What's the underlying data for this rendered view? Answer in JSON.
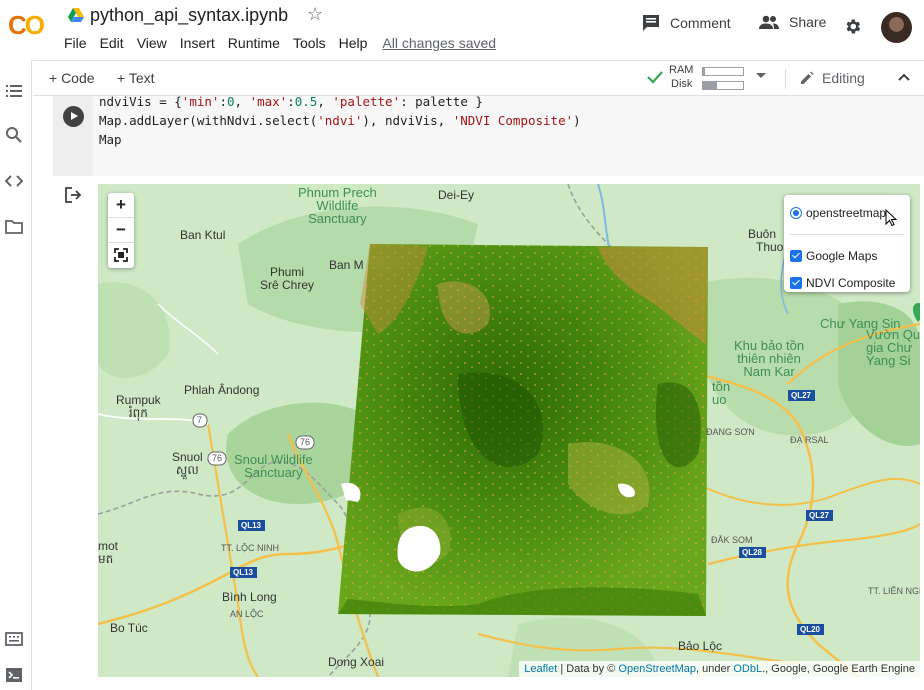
{
  "app": {
    "logo_text": "CO",
    "title": "python_api_syntax.ipynb"
  },
  "menu": [
    "File",
    "Edit",
    "View",
    "Insert",
    "Runtime",
    "Tools",
    "Help"
  ],
  "save_status": "All changes saved",
  "header": {
    "comment_label": "Comment",
    "share_label": "Share"
  },
  "toolbar": {
    "code_label": "+ Code",
    "text_label": "+ Text",
    "ram_label": "RAM",
    "disk_label": "Disk",
    "ram_usage": 0.05,
    "disk_usage": 0.35,
    "editing_label": "Editing"
  },
  "cell": {
    "code_lines": [
      "ndviVis = {'min':0, 'max':0.5, 'palette': palette }",
      "Map.addLayer(withNdvi.select('ndvi'), ndviVis, 'NDVI Composite')",
      "Map"
    ]
  },
  "map": {
    "zoom_in": "+",
    "zoom_out": "−",
    "fullscreen_icon": "fullscreen-icon",
    "layers": {
      "base": "openstreetmap",
      "overlays": [
        "Google Maps",
        "NDVI Composite"
      ]
    },
    "labels": {
      "phnum_prech": "Phnum Prech\nWildlife\nSanctuary",
      "dei_ey": "Dei-Ey",
      "ban_ktul": "Ban Ktul",
      "phumi": "Phumi\nSrê Chrey",
      "ban_m": "Ban M",
      "buon": "Buôn",
      "thuo": "Thuo",
      "chu_yang_sin": "Chư Yang Sin",
      "khu_bao_ton": "Khu bảo tồn\nthiên nhiên\nNam Kar",
      "vuon_qu": "Vườn Qu\ngia Chư\nYang Si",
      "phlah": "Phlah Ândong",
      "rumpuk": "Rumpuk\nរំពុក",
      "snuol": "Snuol\nស្នួល",
      "snoul_wildlife": "Snoul Wildlife\nSanctuary",
      "ton": "tồn\nuo",
      "ql27a": "QL27",
      "dang_son": "ĐANG SƠN",
      "da_rsal": "ĐẠ RSAL",
      "ql27b": "QL27",
      "ql13a": "QL13",
      "tt_loc_ninh": "TT. LỘC NINH",
      "ql13b": "QL13",
      "binh_long": "Bình Long",
      "an_loc": "AN LỘC",
      "bo_tuc": "Bo Túc",
      "dong_xoai": "Dong Xoai",
      "bao_loc": "Bảo Lộc",
      "ql20": "QL20",
      "dak_som": "ĐẮK SOM",
      "ql28": "QL28",
      "tt_lien_nghia": "TT. LIÊN NGH",
      "mot": "mot\nមត",
      "r7": "7",
      "r76a": "76",
      "r76b": "76"
    },
    "attribution": {
      "leaflet": "Leaflet",
      "text1": " | Data by © ",
      "osm": "OpenStreetMap",
      "text2": ", under ",
      "odbl": "ODbL",
      "text3": "., Google, Google Earth Engine"
    }
  },
  "colors": {
    "accent": "#1a73e8",
    "logo": "#f9ab00",
    "ndvi_dark": "#2f6a07",
    "ndvi_mid": "#5a9c12",
    "ndvi_low": "#e89a4a"
  }
}
